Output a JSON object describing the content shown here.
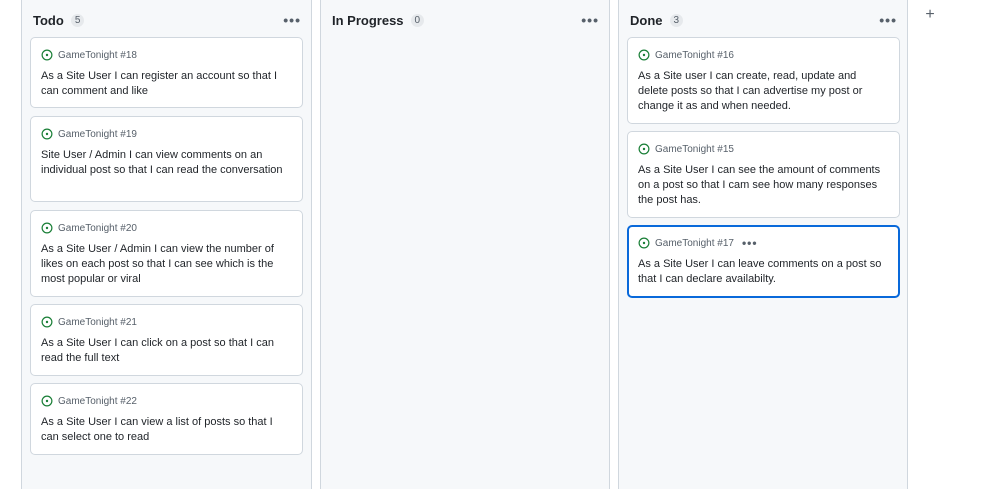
{
  "columns": [
    {
      "title": "Todo",
      "count": "5",
      "cards": [
        {
          "ref": "GameTonight #18",
          "text": "As a Site User I can register an account so that I can comment and like"
        },
        {
          "ref": "GameTonight #19",
          "text": "Site User / Admin I can view comments on an individual post so that I can read the conversation"
        },
        {
          "ref": "GameTonight #20",
          "text": "As a Site User / Admin I can view the number of likes on each post so that I can see which is the most popular or viral"
        },
        {
          "ref": "GameTonight #21",
          "text": "As a Site User I can click on a post so that I can read the full text"
        },
        {
          "ref": "GameTonight #22",
          "text": "As a Site User I can view a list of posts so that I can select one to read"
        }
      ]
    },
    {
      "title": "In Progress",
      "count": "0",
      "cards": []
    },
    {
      "title": "Done",
      "count": "3",
      "cards": [
        {
          "ref": "GameTonight #16",
          "text": "As a Site user I can create, read, update and delete posts so that I can advertise my post or change it as and when needed."
        },
        {
          "ref": "GameTonight #15",
          "text": "As a Site User I can see the amount of comments on a post so that I cam see how many responses the post has."
        },
        {
          "ref": "GameTonight #17",
          "text": "As a Site User I can leave comments on a post so that I can declare availabilty."
        }
      ]
    }
  ],
  "column_menu_glyph": "•••",
  "card_menu_glyph": "•••",
  "add_column_glyph": "+",
  "icons": {
    "issue_open": "issue-opened-icon",
    "menu": "kebab-horizontal-icon",
    "add": "plus-icon"
  },
  "colors": {
    "issue_open": "#1a7f37",
    "selected_border": "#0969da"
  }
}
